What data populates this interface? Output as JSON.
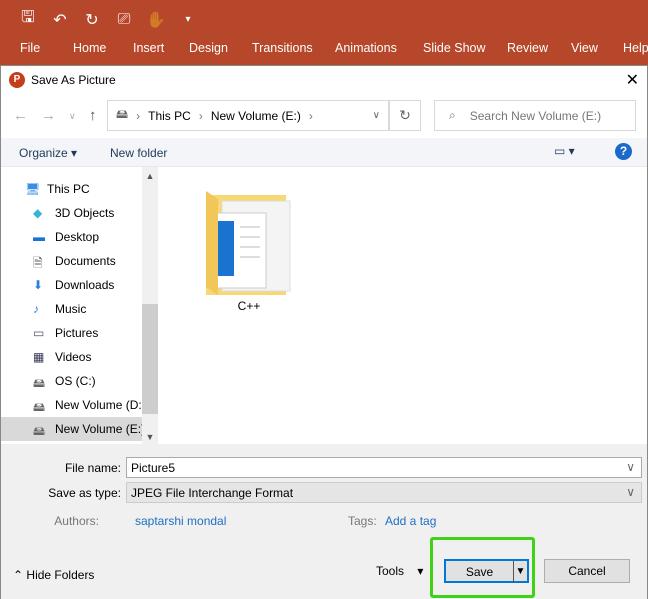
{
  "ribbon": {
    "qat_icons": [
      "save-icon",
      "undo-icon",
      "redo-icon",
      "present-icon",
      "attach-icon",
      "customize-icon"
    ],
    "tabs": [
      "File",
      "Home",
      "Insert",
      "Design",
      "Transitions",
      "Animations",
      "Slide Show",
      "Review",
      "View",
      "Help"
    ],
    "color": "#b7472a"
  },
  "dialog": {
    "title": "Save As Picture",
    "breadcrumb": [
      "This PC",
      "New Volume (E:)"
    ],
    "search_placeholder": "Search New Volume (E:)",
    "organize": "Organize",
    "new_folder": "New folder",
    "nav_items": [
      {
        "label": "This PC",
        "icon": "computer-icon"
      },
      {
        "label": "3D Objects",
        "icon": "cube-icon"
      },
      {
        "label": "Desktop",
        "icon": "desktop-icon"
      },
      {
        "label": "Documents",
        "icon": "documents-icon"
      },
      {
        "label": "Downloads",
        "icon": "download-icon"
      },
      {
        "label": "Music",
        "icon": "music-icon"
      },
      {
        "label": "Pictures",
        "icon": "pictures-icon"
      },
      {
        "label": "Videos",
        "icon": "videos-icon"
      },
      {
        "label": "OS (C:)",
        "icon": "drive-icon"
      },
      {
        "label": "New Volume (D:)",
        "icon": "drive-icon"
      },
      {
        "label": "New Volume (E:)",
        "icon": "drive-icon",
        "selected": true
      }
    ],
    "files": [
      {
        "name": "C++",
        "icon": "folder-icon"
      }
    ],
    "file_name_label": "File name:",
    "file_name": "Picture5",
    "save_type_label": "Save as type:",
    "save_type": "JPEG File Interchange Format",
    "authors_label": "Authors:",
    "authors": "saptarshi mondal",
    "tags_label": "Tags:",
    "tags": "Add a tag",
    "hide_folders": "Hide Folders",
    "tools": "Tools",
    "save": "Save",
    "cancel": "Cancel",
    "highlight_color": "#3fd217"
  }
}
